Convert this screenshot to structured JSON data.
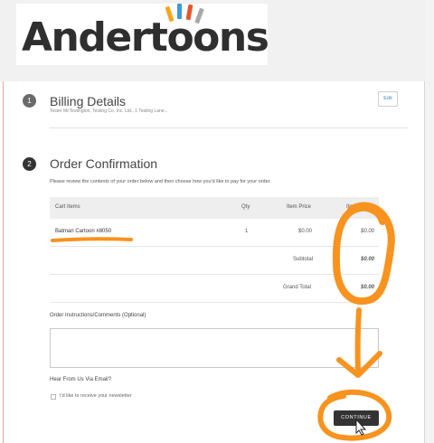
{
  "logo": {
    "text": "Andertoons",
    "bar_colors": [
      "#f7a51d",
      "#3d9bd6",
      "#e5582f",
      "#a8a8a8"
    ]
  },
  "billing": {
    "step": "1",
    "title": "Billing Details",
    "summary": "Tester McTestington, Testing Co, Inc. Ltd., 1 Testing Lane...",
    "edit_label": "Edit"
  },
  "confirmation": {
    "step": "2",
    "title": "Order Confirmation",
    "instructions": "Please review the contents of your order below and then choose how you'd like to pay for your order."
  },
  "cart": {
    "headers": {
      "items": "Cart Items",
      "qty": "Qty",
      "price": "Item Price",
      "total": "Item"
    },
    "rows": [
      {
        "name": "Batman Cartoon #8050",
        "qty": "1",
        "price": "$0.00",
        "total": "$0.00"
      }
    ],
    "subtotal_label": "Subtotal",
    "subtotal_value": "$0.00",
    "grand_total_label": "Grand Total",
    "grand_total_value": "$0.00"
  },
  "comments": {
    "label": "Order Instructions/Comments (Optional)",
    "value": ""
  },
  "newsletter": {
    "heading": "Hear From Us Via Email?",
    "checkbox_label": "I'd like to receive your newsletter",
    "checked": false
  },
  "continue_label": "CONTINUE",
  "colors": {
    "annotation": "#f7931e",
    "button": "#333333",
    "link": "#4a87c5"
  }
}
